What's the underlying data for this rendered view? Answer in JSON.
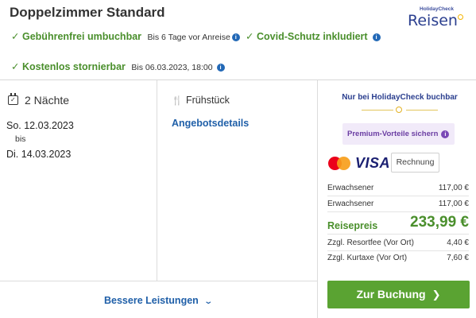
{
  "header": {
    "title": "Doppelzimmer Standard",
    "logo_top": "HolidayCheck",
    "logo_main": "Reisen"
  },
  "features": {
    "umbuchbar": {
      "label": "Gebührenfrei umbuchbar",
      "detail": "Bis 6 Tage vor Anreise"
    },
    "covid": {
      "label": "Covid-Schutz inkludiert"
    },
    "storno": {
      "label": "Kostenlos stornierbar",
      "detail": "Bis 06.03.2023, 18:00"
    }
  },
  "stay": {
    "nights": "2 Nächte",
    "checkin": "So. 12.03.2023",
    "bis": "bis",
    "checkout": "Di. 14.03.2023"
  },
  "offer": {
    "board": "Frühstück",
    "details_link": "Angebotsdetails"
  },
  "footer": {
    "better_services": "Bessere Leistungen"
  },
  "booking": {
    "only_at": "Nur bei HolidayCheck buchbar",
    "premium": "Premium-Vorteile sichern",
    "visa": "VISA",
    "rechnung": "Rechnung",
    "lines": [
      {
        "label": "Erwachsener",
        "value": "117,00 €"
      },
      {
        "label": "Erwachsener",
        "value": "117,00 €"
      }
    ],
    "reisepreis_label": "Reisepreis",
    "reisepreis_value": "233,99 €",
    "extras": [
      {
        "label": "Zzgl. Resortfee (Vor Ort)",
        "value": "4,40 €"
      },
      {
        "label": "Zzgl. Kurtaxe (Vor Ort)",
        "value": "7,60 €"
      }
    ],
    "button": "Zur Buchung"
  },
  "colors": {
    "accent_green": "#5aa332",
    "feature_green": "#4a8f2c",
    "link_blue": "#1f5fa8",
    "brand_navy": "#2b3f8f",
    "premium_purple": "#6b3ea3"
  }
}
